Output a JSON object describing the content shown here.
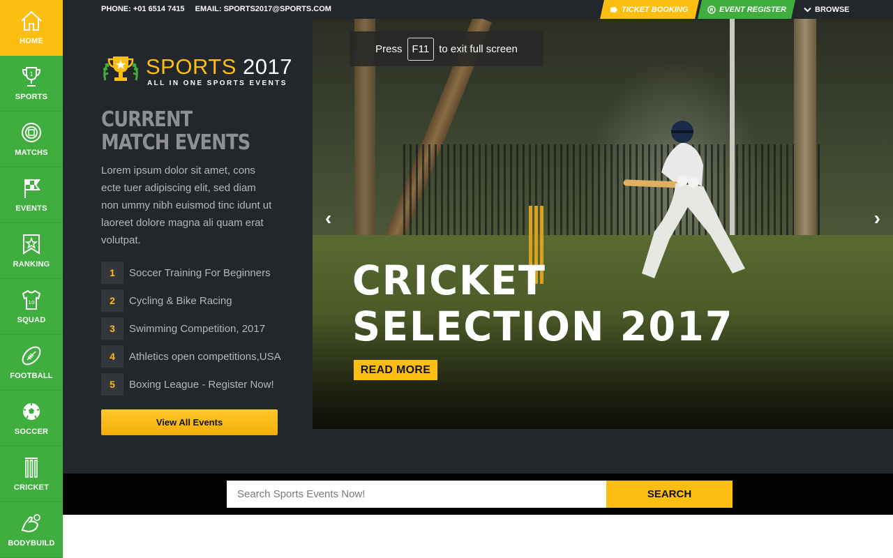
{
  "sidebar": {
    "items": [
      {
        "label": "HOME",
        "icon": "home-icon"
      },
      {
        "label": "SPORTS",
        "icon": "trophy-icon"
      },
      {
        "label": "MATCHS",
        "icon": "target-icon"
      },
      {
        "label": "EVENTS",
        "icon": "flag-icon"
      },
      {
        "label": "RANKING",
        "icon": "badge-icon"
      },
      {
        "label": "SQUAD",
        "icon": "jersey-icon"
      },
      {
        "label": "FOOTBALL",
        "icon": "football-icon"
      },
      {
        "label": "SOCCER",
        "icon": "soccer-ball-icon"
      },
      {
        "label": "CRICKET",
        "icon": "wickets-icon"
      },
      {
        "label": "BODYBUILD",
        "icon": "muscle-icon"
      }
    ]
  },
  "topbar": {
    "phone": "PHONE: +01 6514 7415",
    "email": "EMAIL: SPORTS2017@SPORTS.COM",
    "ticket_booking": "TICKET BOOKING",
    "event_register": "EVENT REGISTER",
    "browse": "BROWSE"
  },
  "logo": {
    "name": "SPORTS",
    "year": "2017",
    "tagline": "ALL IN ONE SPORTS EVENTS"
  },
  "current_match": {
    "title": "CURRENT MATCH EVENTS",
    "description": "Lorem ipsum dolor sit amet, cons ecte tuer adipiscing elit, sed diam non ummy nibh euismod tinc idunt ut laoreet dolore magna ali quam erat volutpat.",
    "events": [
      {
        "num": "1",
        "label": "Soccer Training For Beginners"
      },
      {
        "num": "2",
        "label": "Cycling & Bike Racing"
      },
      {
        "num": "3",
        "label": "Swimming Competition, 2017"
      },
      {
        "num": "4",
        "label": "Athletics open competitions,USA"
      },
      {
        "num": "5",
        "label": "Boxing League - Register Now!"
      }
    ],
    "view_all": "View All Events"
  },
  "hero": {
    "fullscreen_press": "Press",
    "fullscreen_key": "F11",
    "fullscreen_suffix": "to exit full screen",
    "title_line1": "CRICKET",
    "title_line2": "SELECTION 2017",
    "read_more": "READ MORE",
    "prev": "‹",
    "next": "›"
  },
  "search": {
    "placeholder": "Search Sports Events Now!",
    "button": "SEARCH"
  },
  "colors": {
    "green": "#3fae3f",
    "yellow": "#fdbe12",
    "dark": "#23262b"
  }
}
